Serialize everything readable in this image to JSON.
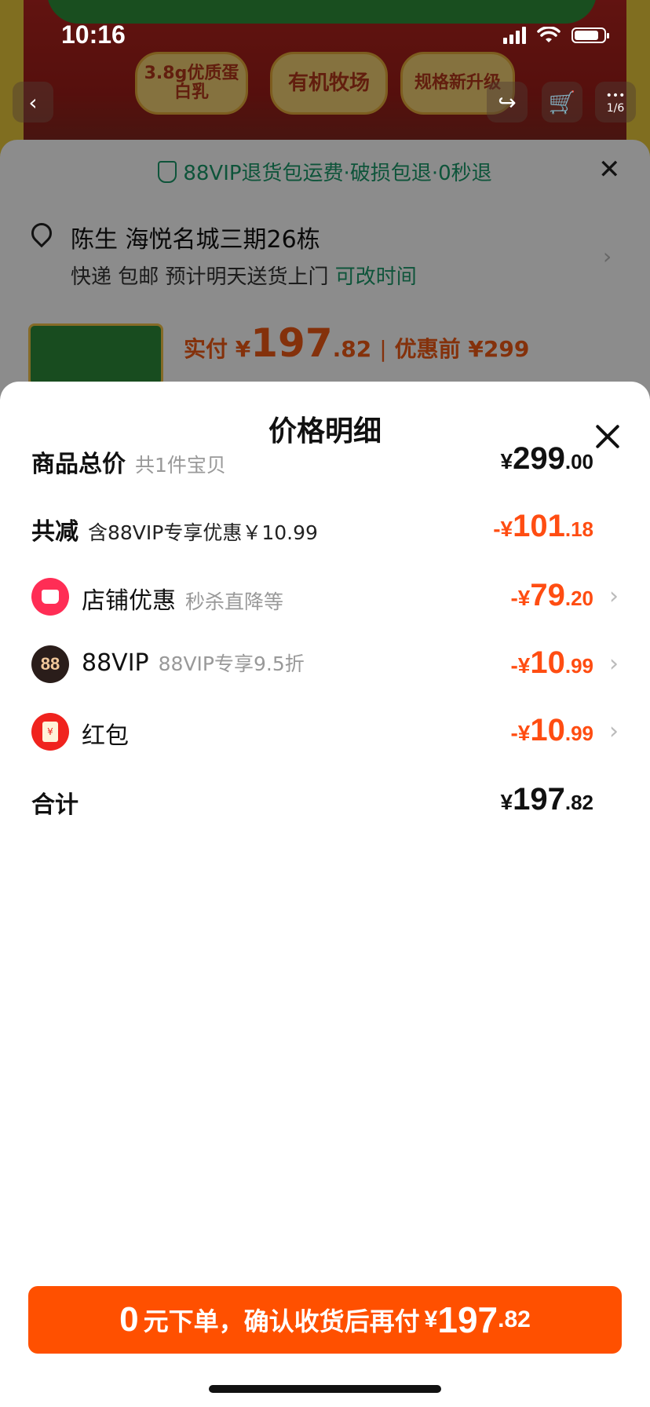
{
  "status": {
    "time": "10:16"
  },
  "hero": {
    "pills": [
      "3.8g优质蛋白乳",
      "有机牧场",
      "规格新升级"
    ],
    "page_counter": "1/6"
  },
  "background": {
    "vip_banner": "88VIP退货包运费·破损包退·0秒退",
    "address_name": "陈生 海悦名城三期26栋",
    "delivery_text": "快递 包邮 预计明天送货上门",
    "delivery_change": "可改时间",
    "pay_prefix": "实付",
    "pay_yen": "¥",
    "pay_int": "197",
    "pay_dec": ".82",
    "pre_discount": "优惠前 ¥299"
  },
  "modal": {
    "title": "价格明细",
    "rows": [
      {
        "label": "商品总价",
        "sub": "共1件宝贝",
        "yen": "¥",
        "int": "299",
        "dec": ".00"
      },
      {
        "label": "共减",
        "sub": "含88VIP专享优惠￥10.99",
        "yen": "-¥",
        "int": "101",
        "dec": ".18"
      },
      {
        "label": "店铺优惠",
        "sub": "秒杀直降等",
        "yen": "-¥",
        "int": "79",
        "dec": ".20",
        "icon": "store-icon"
      },
      {
        "label": "88VIP",
        "sub": "88VIP专享9.5折",
        "yen": "-¥",
        "int": "10",
        "dec": ".99",
        "icon": "vip-88-icon",
        "icon_text": "88"
      },
      {
        "label": "红包",
        "sub": "",
        "yen": "-¥",
        "int": "10",
        "dec": ".99",
        "icon": "red-packet-icon",
        "icon_text": "¥"
      },
      {
        "label": "合计",
        "sub": "",
        "yen": "¥",
        "int": "197",
        "dec": ".82"
      }
    ]
  },
  "cta": {
    "zero": "0",
    "text": "元下单，确认收货后再付",
    "yen": "¥",
    "int": "197",
    "dec": ".82"
  },
  "colors": {
    "accent": "#ff5000",
    "discount": "#ff4d12",
    "vip_green": "#1a9a6a"
  }
}
